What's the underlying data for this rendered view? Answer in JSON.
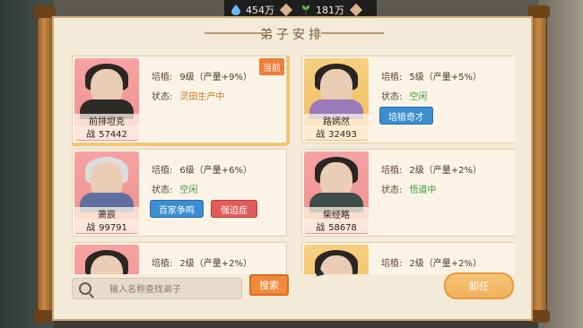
{
  "resources": [
    {
      "icon": "water-drop-icon",
      "value": "454万"
    },
    {
      "icon": "plant-icon",
      "value": "181万"
    }
  ],
  "panel": {
    "title": "弟子安排"
  },
  "labels": {
    "cultivate": "培植:",
    "status": "状态:",
    "power": "战"
  },
  "disciples": [
    {
      "name": "前排坦克",
      "power": "57442",
      "cultivate": "9级（产量+9%）",
      "status": "灵田生产中",
      "status_type": "busy",
      "current_badge": "当前",
      "buttons": [],
      "selected": true
    },
    {
      "name": "路嫣然",
      "power": "32493",
      "cultivate": "5级（产量+5%）",
      "status": "空闲",
      "status_type": "free",
      "buttons": [
        "培植奇才"
      ]
    },
    {
      "name": "萧辰",
      "power": "99791",
      "cultivate": "6级（产量+6%）",
      "status": "空闲",
      "status_type": "free",
      "buttons": [
        "百家争鸣",
        "强迫症"
      ]
    },
    {
      "name": "柴经略",
      "power": "58678",
      "cultivate": "2级（产量+2%）",
      "status": "悟道中",
      "status_type": "free",
      "buttons": []
    },
    {
      "name": "",
      "power": "",
      "cultivate": "2级（产量+2%）",
      "status": "",
      "status_type": "",
      "buttons": []
    },
    {
      "name": "",
      "power": "",
      "cultivate": "2级（产量+2%）",
      "status": "",
      "status_type": "",
      "buttons": []
    }
  ],
  "search": {
    "placeholder": "输入名称查找弟子",
    "button": "搜索"
  },
  "unload": "卸任",
  "colors": {
    "accent_orange": "#f08a3a",
    "status_green": "#3f9b3a",
    "status_orange": "#c07a24"
  }
}
